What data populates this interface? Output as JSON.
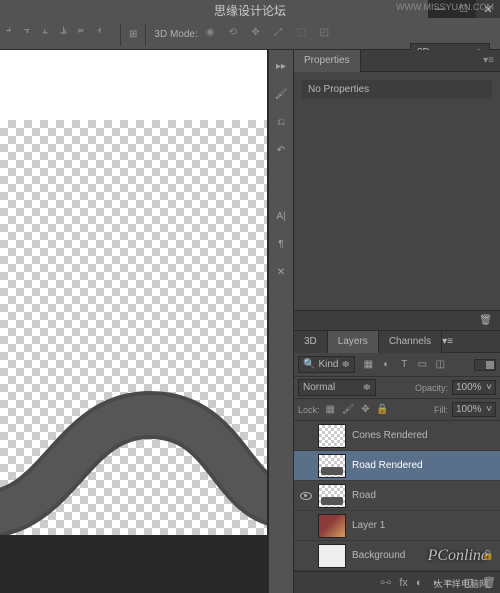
{
  "watermarks": {
    "top_cn": "思缘设计论坛",
    "top_url": "WWW.MISSYUAN.COM",
    "bottom_brand": "PConline",
    "bottom_cn": "太平洋电脑网"
  },
  "options_bar": {
    "mode_label": "3D Mode:",
    "dropdown_3d": "3D"
  },
  "properties_panel": {
    "tab": "Properties",
    "subtitle": "No Properties"
  },
  "layers_panel": {
    "tabs": [
      "3D",
      "Layers",
      "Channels"
    ],
    "filter_kind": "Kind",
    "blend_mode": "Normal",
    "opacity_label": "Opacity:",
    "opacity_value": "100%",
    "lock_label": "Lock:",
    "fill_label": "Fill:",
    "fill_value": "100%",
    "layers": [
      {
        "name": "Cones Rendered",
        "visible": false,
        "selected": false,
        "thumb": "checker"
      },
      {
        "name": "Road Rendered",
        "visible": false,
        "selected": true,
        "thumb": "checker-road"
      },
      {
        "name": "Road",
        "visible": true,
        "selected": false,
        "thumb": "checker-road"
      },
      {
        "name": "Layer 1",
        "visible": false,
        "selected": false,
        "thumb": "image"
      },
      {
        "name": "Background",
        "visible": false,
        "selected": false,
        "thumb": "bg",
        "locked": true
      }
    ]
  }
}
